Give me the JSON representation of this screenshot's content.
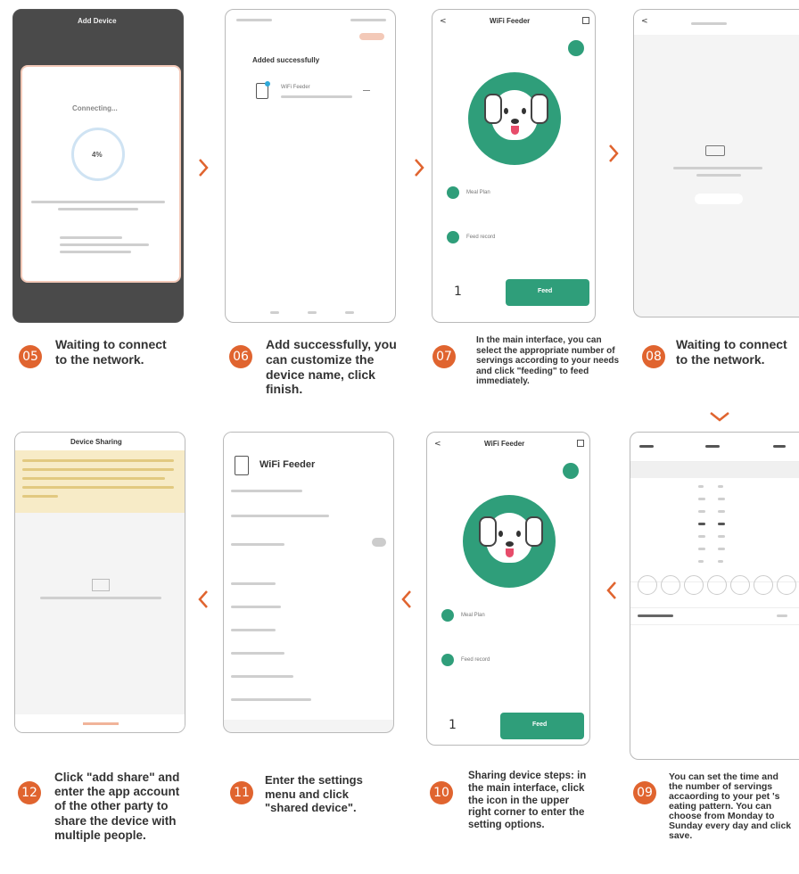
{
  "colors": {
    "accent": "#e0642f",
    "green": "#2f9e7a"
  },
  "steps": [
    {
      "num": "05",
      "text": "Waiting to connect to the network."
    },
    {
      "num": "06",
      "text": "Add successfully, you can customize the device name, click finish."
    },
    {
      "num": "07",
      "text": "In the main interface, you can select the appropriate number of servings according to your needs and click \"feeding\" to feed immediately."
    },
    {
      "num": "08",
      "text": "Waiting to connect to the network."
    },
    {
      "num": "09",
      "text": "You can set the time and the number of servings accaording to your pet 's eating pattern. You can choose from Monday to Sunday every day and click save."
    },
    {
      "num": "10",
      "text": "Sharing device steps: in the main interface, click the icon in the upper right corner to enter the setting options."
    },
    {
      "num": "11",
      "text": "Enter the settings menu and click \"shared device\"."
    },
    {
      "num": "12",
      "text": "Click \"add share\" and enter the app account of the other party to share the device with multiple people."
    }
  ],
  "screens": {
    "s05": {
      "title": "Add Device",
      "status": "Connecting...",
      "progress": "4%"
    },
    "s06": {
      "title": "Added successfully",
      "device": "WiFi Feeder"
    },
    "s07": {
      "title": "WiFi Feeder",
      "meal_plan": "Meal Plan",
      "feed_record": "Feed record",
      "count": "1",
      "feed": "Feed"
    },
    "s10": {
      "title": "WiFi Feeder",
      "meal_plan": "Meal Plan",
      "feed_record": "Feed record",
      "count": "1",
      "feed": "Feed"
    },
    "s11": {
      "title": "WiFi Feeder"
    },
    "s12": {
      "title": "Device Sharing"
    }
  }
}
